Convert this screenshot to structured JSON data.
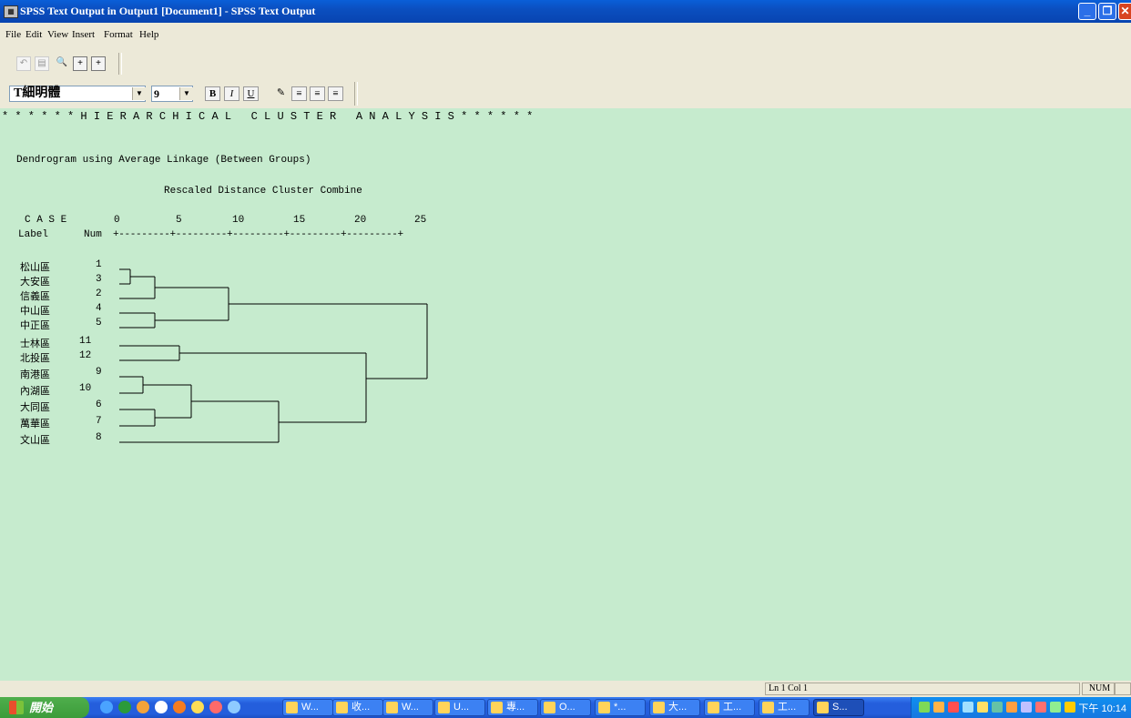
{
  "window": {
    "title": "SPSS Text Output in Output1 [Document1] - SPSS Text Output",
    "app_icon": "spss-icon",
    "controls": [
      "minimize",
      "restore",
      "close"
    ]
  },
  "menu": [
    "File",
    "Edit",
    "View",
    "Insert",
    "Format",
    "Help"
  ],
  "toolbar": {
    "icons": [
      "undo-icon",
      "text-icon",
      "find-icon",
      "insert-icon",
      "insert2-icon"
    ]
  },
  "format_toolbar": {
    "font_name": "T細明體",
    "font_size": "9",
    "buttons": [
      "B",
      "I",
      "U"
    ],
    "icons": [
      "color-icon",
      "align-left-icon",
      "align-center-icon",
      "align-right-icon"
    ]
  },
  "output": {
    "header": "* * * * * * H I E R A R C H I C A L   C L U S T E R   A N A L Y S I S * * * * * *",
    "method": "Dendrogram using Average Linkage (Between Groups)",
    "scale_title": "Rescaled Distance Cluster Combine",
    "case_label": "C A S E",
    "ticks": [
      "0",
      "5",
      "10",
      "15",
      "20",
      "25"
    ],
    "col_label": "Label",
    "col_num": "Num",
    "axis_line": "+---------+---------+---------+---------+---------+",
    "cases": [
      {
        "label": "松山區",
        "num": "1"
      },
      {
        "label": "大安區",
        "num": "3"
      },
      {
        "label": "信義區",
        "num": "2"
      },
      {
        "label": "中山區",
        "num": "4"
      },
      {
        "label": "中正區",
        "num": "5"
      },
      {
        "label": "士林區",
        "num": "11"
      },
      {
        "label": "北投區",
        "num": "12"
      },
      {
        "label": "南港區",
        "num": "9"
      },
      {
        "label": "內湖區",
        "num": "10"
      },
      {
        "label": "大同區",
        "num": "6"
      },
      {
        "label": "萬華區",
        "num": "7"
      },
      {
        "label": "文山區",
        "num": "8"
      }
    ]
  },
  "status": {
    "position": "Ln 1 Col 1",
    "num": "NUM"
  },
  "taskbar": {
    "start": "開始",
    "tasks": [
      "W...",
      "收...",
      "W...",
      "U...",
      "專...",
      "O...",
      "*...",
      "大...",
      "工...",
      "工...",
      "S..."
    ],
    "clock": "下午 10:14"
  }
}
